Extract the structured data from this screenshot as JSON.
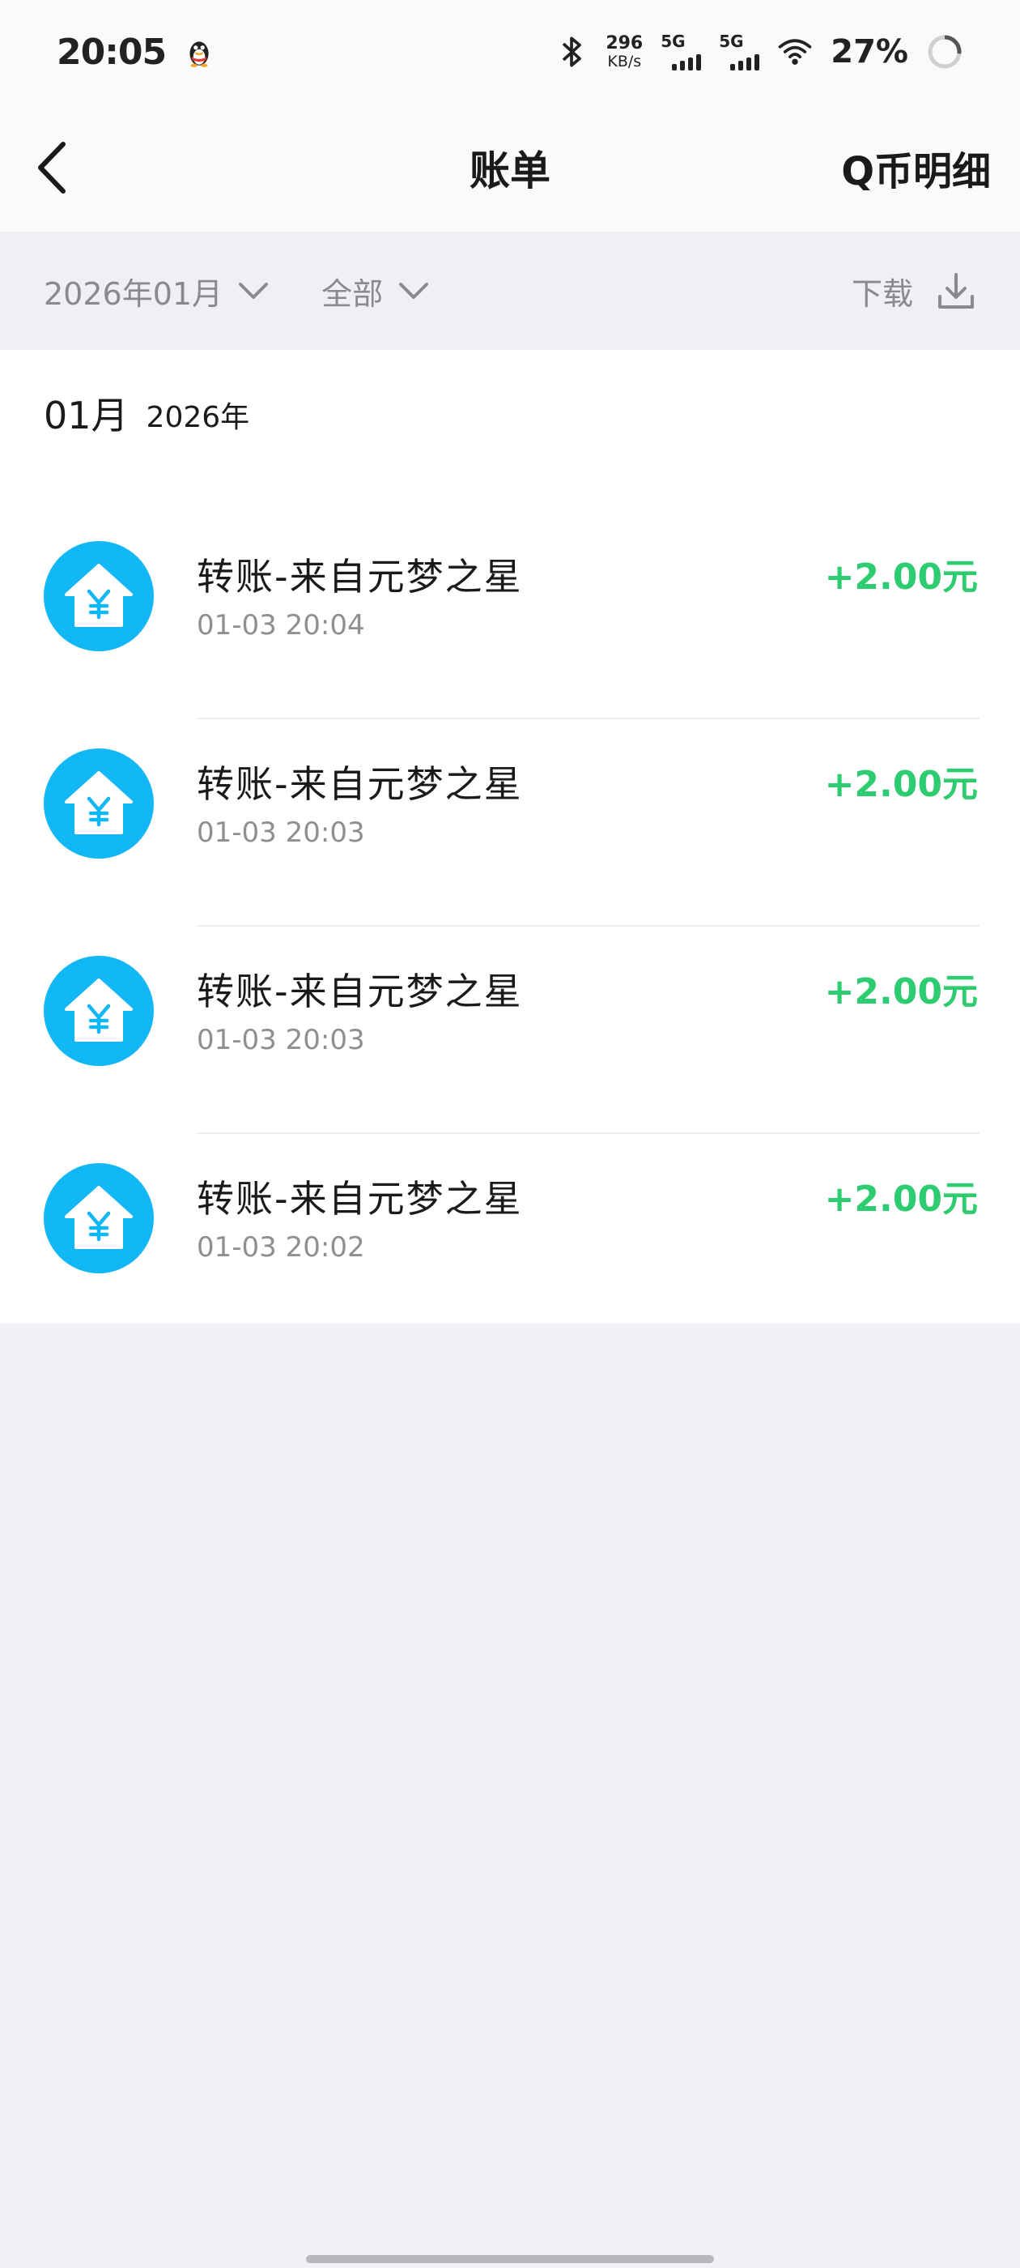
{
  "status_bar": {
    "time": "20:05",
    "net_speed_value": "296",
    "net_speed_unit": "KB/s",
    "sim1_label": "5G",
    "sim2_label": "5G",
    "battery_percent": "27%",
    "icons": [
      "qq-penguin-icon",
      "bluetooth-icon",
      "signal-icon",
      "signal-icon",
      "wifi-icon",
      "battery-ring-icon"
    ]
  },
  "nav": {
    "title": "账单",
    "right_link": "Q币明细",
    "back_icon": "chevron-left-icon"
  },
  "filters": {
    "month": "2026年01月",
    "type": "全部",
    "download": "下载"
  },
  "section": {
    "month": "01月",
    "year": "2026年"
  },
  "transactions": [
    {
      "title": "转账-来自元梦之星",
      "time": "01-03 20:04",
      "amount": "+2.00元"
    },
    {
      "title": "转账-来自元梦之星",
      "time": "01-03 20:03",
      "amount": "+2.00元"
    },
    {
      "title": "转账-来自元梦之星",
      "time": "01-03 20:03",
      "amount": "+2.00元"
    },
    {
      "title": "转账-来自元梦之星",
      "time": "01-03 20:02",
      "amount": "+2.00元"
    }
  ],
  "colors": {
    "accent_blue": "#12b7f5",
    "income_green": "#2ecc71",
    "background": "#f0f0f5"
  }
}
